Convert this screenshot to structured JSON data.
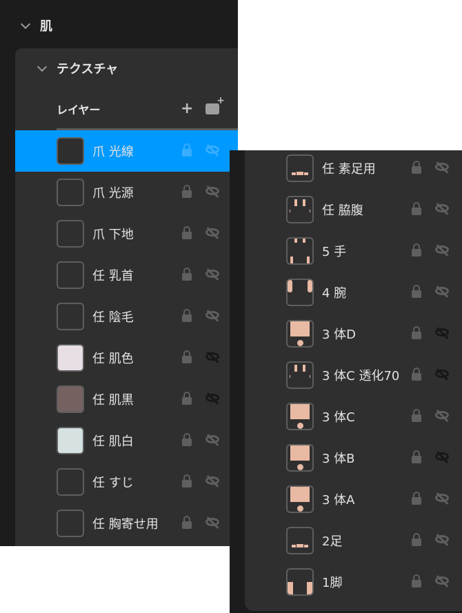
{
  "section": {
    "title": "肌"
  },
  "texture": {
    "title": "テクスチャ"
  },
  "layers": {
    "label": "レイヤー",
    "add_icon": "plus-icon",
    "add_image_icon": "image-add-icon"
  },
  "colors": {
    "selected": "#0099ff",
    "card": "#2f2f2f",
    "bg": "#1c1c1c"
  },
  "left_layers": [
    {
      "name": "爪 光線",
      "selected": true,
      "thumb": "#2e2e2e",
      "eye": "light"
    },
    {
      "name": "爪 光源",
      "thumb": "",
      "eye": "light"
    },
    {
      "name": "爪 下地",
      "thumb": "",
      "eye": "light"
    },
    {
      "name": "任 乳首",
      "thumb": "",
      "eye": "light"
    },
    {
      "name": "任 陰毛",
      "thumb": "",
      "eye": "light"
    },
    {
      "name": "任 肌色",
      "thumb": "#e8dfe6",
      "eye": "dark"
    },
    {
      "name": "任 肌黒",
      "thumb": "#756260",
      "eye": "dark"
    },
    {
      "name": "任 肌白",
      "thumb": "#d6e2e2",
      "eye": "light"
    },
    {
      "name": "任 すじ",
      "thumb": "",
      "eye": "light"
    },
    {
      "name": "任 胸寄せ用",
      "thumb": "",
      "eye": "light"
    }
  ],
  "right_layers": [
    {
      "name": "任 素足用",
      "eye": "light",
      "skin": "feet"
    },
    {
      "name": "任 脇腹",
      "eye": "light",
      "skin": "sides"
    },
    {
      "name": "5 手",
      "eye": "light",
      "skin": "hands"
    },
    {
      "name": "4 腕",
      "eye": "light",
      "skin": "arms"
    },
    {
      "name": "3 体D",
      "eye": "dark",
      "skin": "body"
    },
    {
      "name": "3 体C 透化70",
      "eye": "dark",
      "skin": "sides"
    },
    {
      "name": "3 体C",
      "eye": "light",
      "skin": "body"
    },
    {
      "name": "3 体B",
      "eye": "dark",
      "skin": "body"
    },
    {
      "name": "3 体A",
      "eye": "light",
      "skin": "body"
    },
    {
      "name": "2足",
      "eye": "light",
      "skin": "feet"
    },
    {
      "name": "1脚",
      "eye": "light",
      "skin": "legs"
    }
  ]
}
